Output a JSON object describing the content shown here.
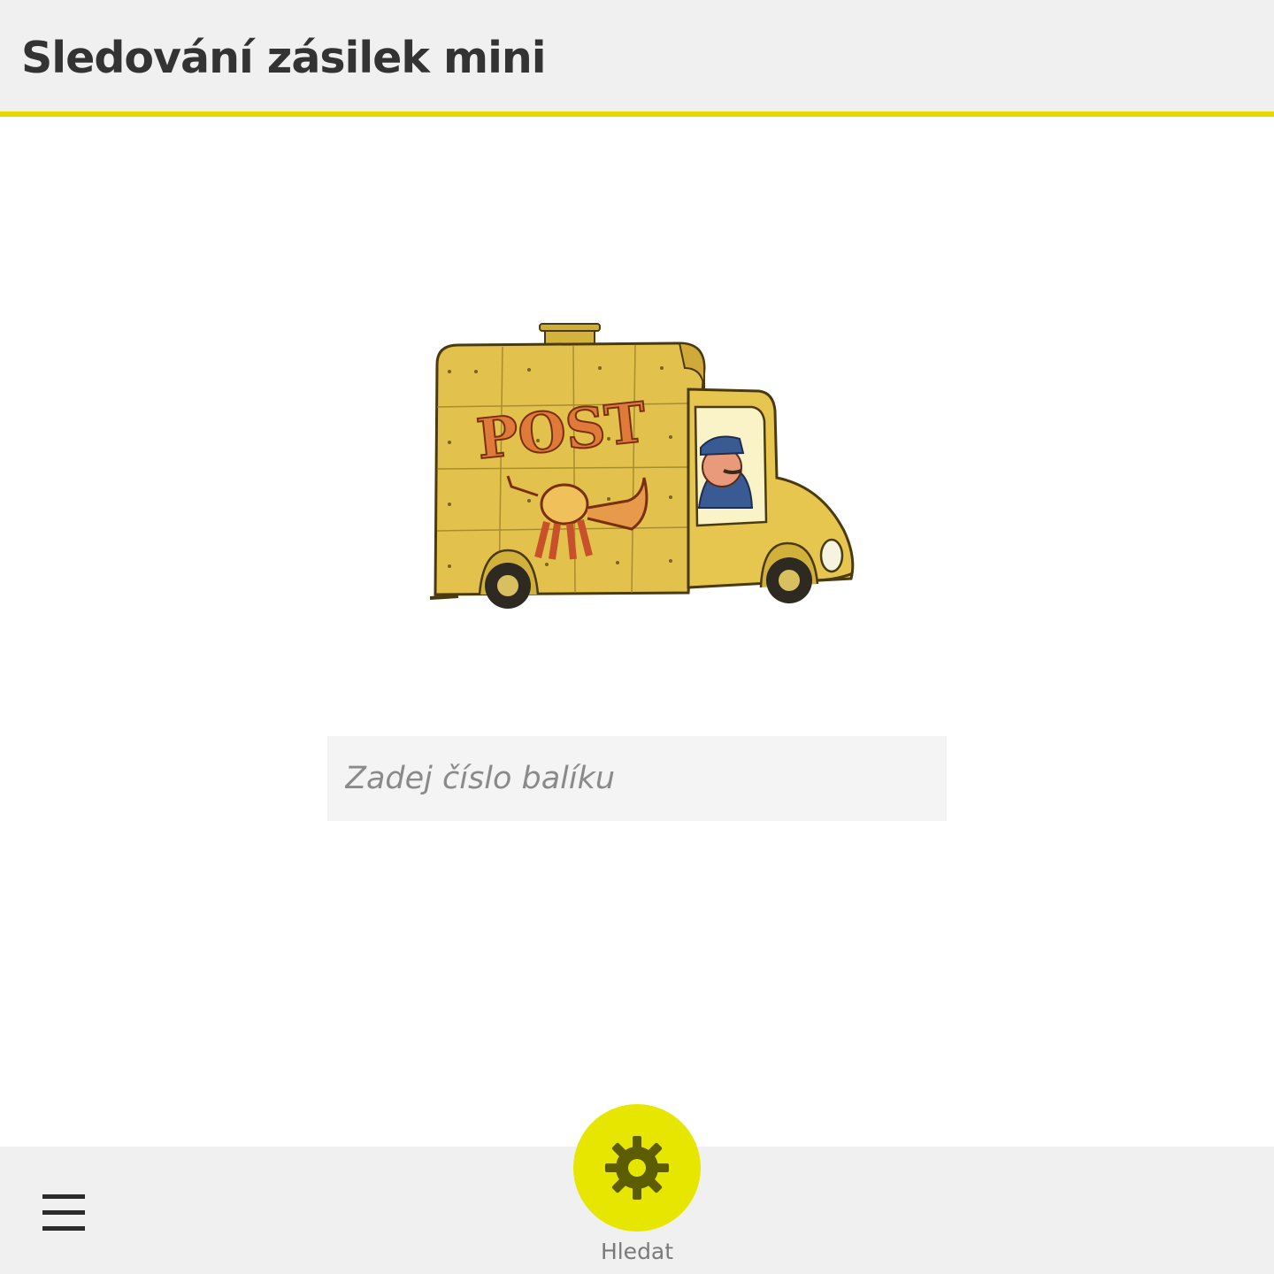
{
  "app": {
    "title": "Sledování zásilek mini",
    "accent_color": "#e4da00"
  },
  "illustration": {
    "name": "post-van-illustration",
    "van_text": "POST",
    "body_color": "#e8c94e"
  },
  "search": {
    "placeholder": "Zadej číslo balíku",
    "value": ""
  },
  "action_bar": {
    "menu_icon": "hamburger-menu-icon",
    "primary_action": {
      "label": "Hledat",
      "icon": "gear-icon",
      "color": "#e6e600"
    }
  }
}
